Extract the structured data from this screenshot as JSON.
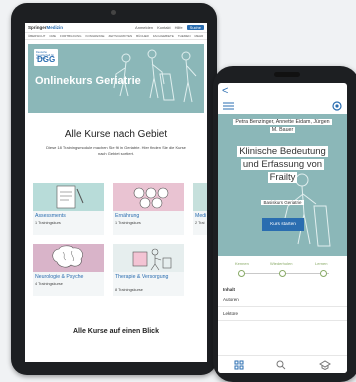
{
  "tablet": {
    "logo_prefix": "Springer",
    "logo_suffix": "Medizin",
    "top_links": [
      "Anmelden",
      "Kontakt",
      "Hilfe"
    ],
    "search_button": "Suche",
    "nav_items": [
      "ÜBERSICHT",
      "CME",
      "FORTBILDUNG",
      "KONGRESSE",
      "ZEITSCHRIFTEN",
      "BÜCHER",
      "FACHGEBIETE",
      "THEMEN",
      "MEHR"
    ],
    "hero_badge_small": "Deutsche Gesellschaft für Geriatrie",
    "hero_badge_big": "DGG",
    "hero_title": "Onlinekurs Geriatrie",
    "heading": "Alle Kurse nach Gebiet",
    "description_line1": "Diese 18 Trainingsmodule machen Sie fit in Geriatrie. Hier finden Sie die Kurse",
    "description_line2": "nach Gebiet sortiert.",
    "cards": [
      {
        "title": "Assessments",
        "subtitle": "1 Trainingskurs"
      },
      {
        "title": "Ernährung",
        "subtitle": "1 Trainingskurs"
      },
      {
        "title": "Medi",
        "subtitle": "2 Trai"
      },
      {
        "title": "Neurologie & Psyche",
        "subtitle": "4 Trainingskurse"
      },
      {
        "title": "Therapie & Versorgung",
        "subtitle": "8 Trainingskurse"
      }
    ],
    "bottom_heading": "Alle Kurse auf einen Blick"
  },
  "phone": {
    "back_label": "<",
    "authors": [
      "Petra Benzinger, Annette Eidam, Jürgen",
      "M. Bauer"
    ],
    "title_lines": [
      "Klinische Bedeutung",
      "und Erfassung von",
      "Frailty"
    ],
    "course_label": "Basiskurs Geriatrie",
    "start_button": "Kurs starten",
    "progress_steps": [
      "Kennen",
      "Wiederholen",
      "Lernen"
    ],
    "section_label": "Inhalt",
    "rows": [
      "Autoren",
      "Lektüre"
    ]
  },
  "colors": {
    "hero_teal": "#8bb7b8",
    "brand_blue": "#2a6db0"
  }
}
